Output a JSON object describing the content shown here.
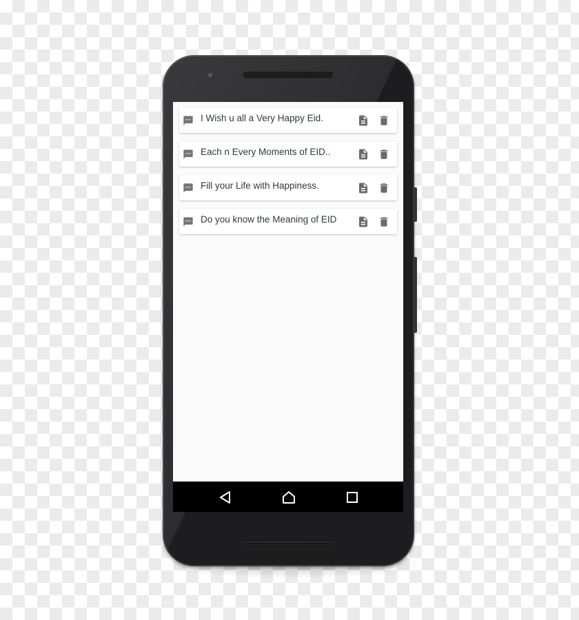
{
  "device": {
    "type": "android-phone",
    "background": "transparency-checkerboard"
  },
  "messages": [
    {
      "text": "I Wish u all a Very Happy Eid.",
      "icon": "message-icon",
      "actions": [
        "doc-icon",
        "trash-icon"
      ]
    },
    {
      "text": "Each n Every Moments of EID..",
      "icon": "message-icon",
      "actions": [
        "doc-icon",
        "trash-icon"
      ]
    },
    {
      "text": "Fill your Life with Happiness.",
      "icon": "message-icon",
      "actions": [
        "doc-icon",
        "trash-icon"
      ]
    },
    {
      "text": "Do you know the Meaning of EID",
      "icon": "message-icon",
      "actions": [
        "doc-icon",
        "trash-icon"
      ]
    }
  ],
  "navbar": {
    "buttons": [
      "back",
      "home",
      "recents"
    ]
  },
  "colors": {
    "screen_bg": "#fafafa",
    "card_bg": "#ffffff",
    "text": "#2e3a3a",
    "icon": "#6b6b6b",
    "navbar_bg": "#000000",
    "phone_body": "#1d1d1f"
  }
}
